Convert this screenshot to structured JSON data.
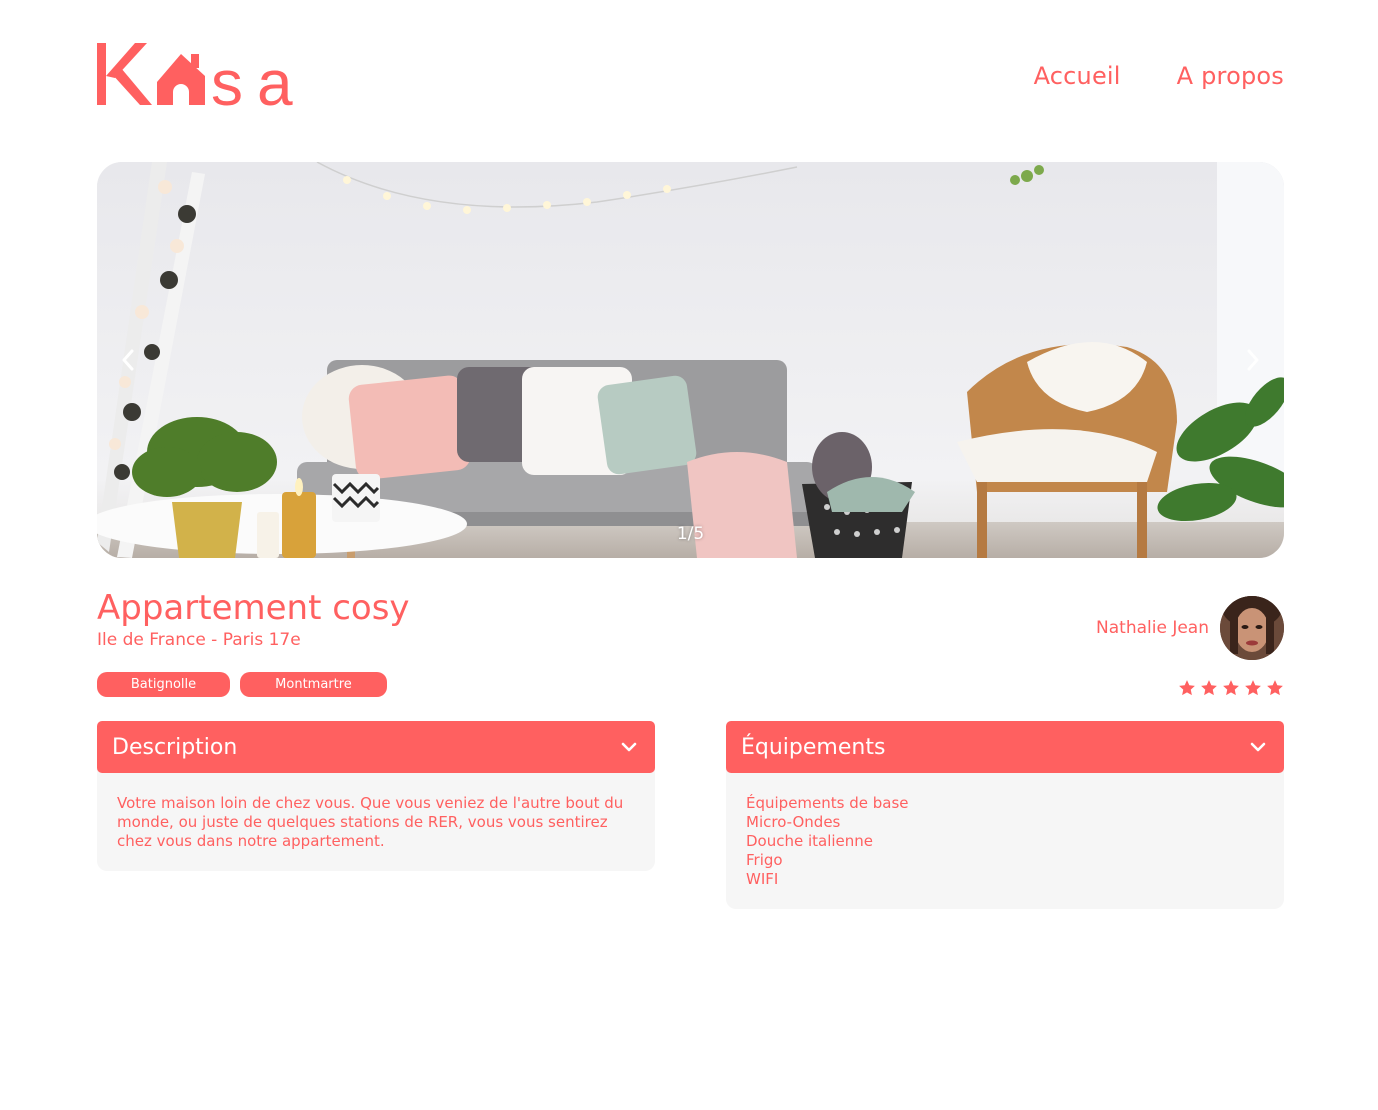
{
  "brand": {
    "name": "Kasa",
    "color": "#FF6060"
  },
  "nav": {
    "home": "Accueil",
    "about": "A propos"
  },
  "carousel": {
    "counter": "1/5",
    "prev_icon": "chevron-left-icon",
    "next_icon": "chevron-right-icon",
    "image_subject": "living-room-photo"
  },
  "listing": {
    "title": "Appartement cosy",
    "location": "Ile de France - Paris 17e",
    "tags": [
      "Batignolle",
      "Montmartre"
    ]
  },
  "host": {
    "name": "Nathalie Jean"
  },
  "rating": {
    "value": 5,
    "max": 5
  },
  "collapses": {
    "description": {
      "title": "Description",
      "text": "Votre maison loin de chez vous. Que vous veniez de l'autre bout du monde, ou juste de quelques stations de RER, vous vous sentirez chez vous dans notre appartement."
    },
    "equipments": {
      "title": "Équipements",
      "items": [
        "Équipements de base",
        "Micro-Ondes",
        "Douche italienne",
        "Frigo",
        "WIFI"
      ]
    }
  }
}
